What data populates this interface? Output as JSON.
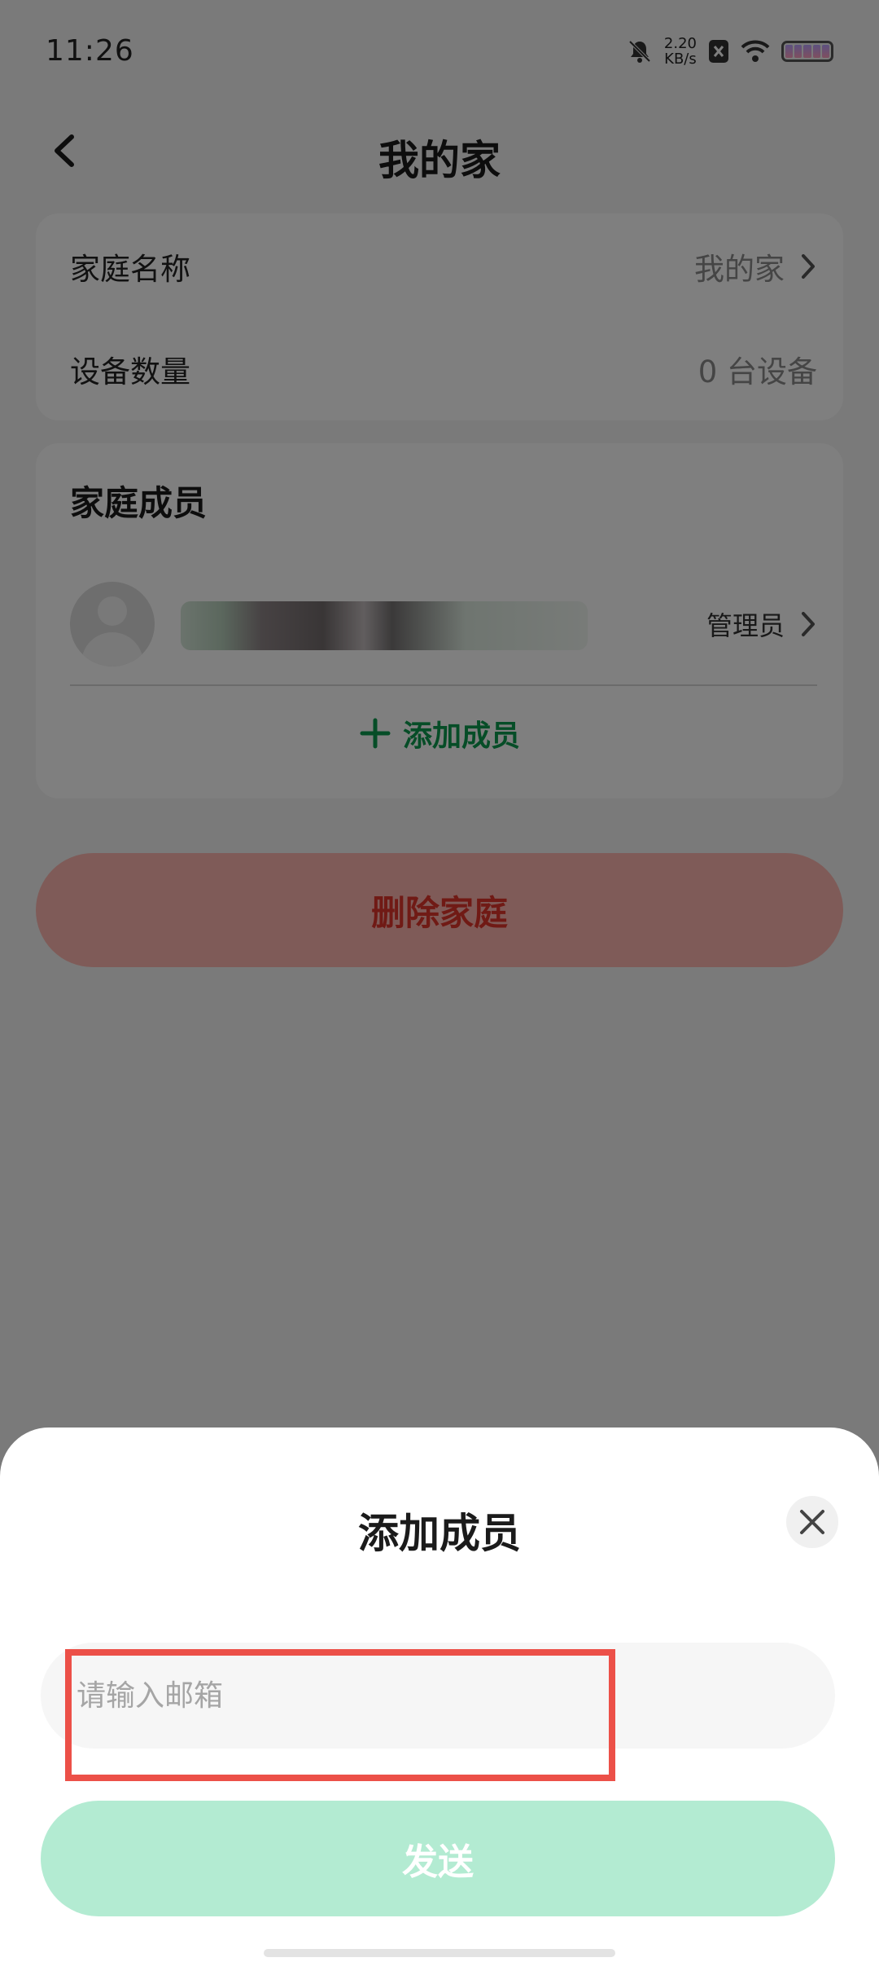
{
  "status_bar": {
    "time": "11:26",
    "net_speed_value": "2.20",
    "net_speed_unit": "KB/s"
  },
  "header": {
    "title": "我的家"
  },
  "family_info": {
    "name_label": "家庭名称",
    "name_value": "我的家",
    "device_label": "设备数量",
    "device_value": "0 台设备"
  },
  "members": {
    "section_title": "家庭成员",
    "items": [
      {
        "role": "管理员"
      }
    ],
    "add_label": "添加成员"
  },
  "delete_button_label": "删除家庭",
  "dialog": {
    "title": "添加成员",
    "email_placeholder": "请输入邮箱",
    "send_label": "发送"
  },
  "colors": {
    "accent_green": "#0c9a4e",
    "danger_red": "#e0342a",
    "send_disabled": "#b3ebd2",
    "highlight_red": "#ec5048"
  }
}
